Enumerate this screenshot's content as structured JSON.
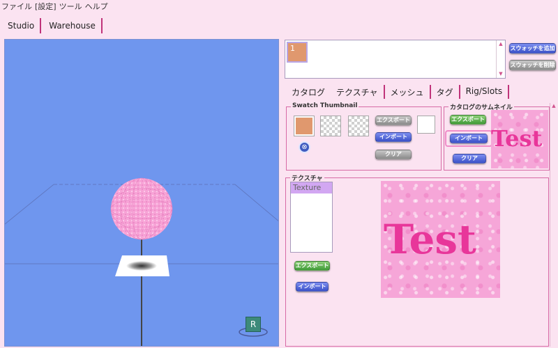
{
  "menu": [
    "ファイル",
    "[設定]",
    "ツール",
    "ヘルプ"
  ],
  "main_tabs": [
    "Studio",
    "Warehouse"
  ],
  "viewport": {
    "gizmo_label": "R"
  },
  "swatch_list": {
    "selected": "1"
  },
  "swatch_buttons": {
    "add": "スウォッチを追加",
    "delete": "スウォッチを削除"
  },
  "sub_tabs": [
    "カタログ",
    "テクスチャ",
    "メッシュ",
    "タグ",
    "Rig/Slots"
  ],
  "swatch_thumb": {
    "legend": "Swatch Thumbnail",
    "export": "エクスポート",
    "import": "インポート",
    "clear": "クリア"
  },
  "catalog_thumb": {
    "legend": "カタログのサムネイル",
    "export": "エクスポート",
    "import": "インポート",
    "clear": "クリア",
    "preview_text": "Test"
  },
  "texture": {
    "legend": "テクスチャ",
    "list_item": "Texture",
    "export": "エクスポート",
    "import": "インポート",
    "preview_text": "Test"
  },
  "colors": {
    "swatch": "#e0986e",
    "accent": "#c0337a",
    "viewport_bg": "#6f96ee"
  }
}
